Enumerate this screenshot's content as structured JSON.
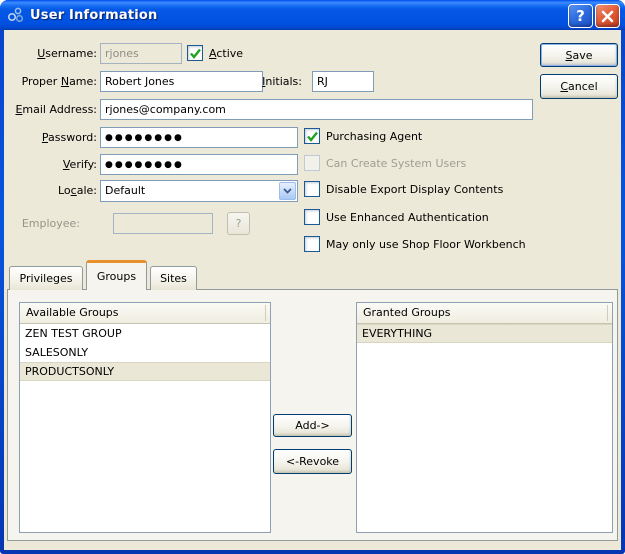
{
  "window": {
    "title": "User Information",
    "help_glyph": "?"
  },
  "form": {
    "username": {
      "label": {
        "text": "Username:",
        "u": 0
      },
      "value": "rjones",
      "disabled": true
    },
    "active": {
      "label": {
        "text": "Active",
        "u": 0
      },
      "checked": true
    },
    "proper_name": {
      "label": {
        "text": "Proper Name:",
        "u": 7
      },
      "value": "Robert Jones"
    },
    "initials": {
      "label": {
        "text": "Initials:",
        "u": 0
      },
      "value": "RJ"
    },
    "email": {
      "label": {
        "text": "Email Address:",
        "u": 0
      },
      "value": "rjones@company.com"
    },
    "password": {
      "label": {
        "text": "Password:",
        "u": 0
      },
      "value": "●●●●●●●●"
    },
    "verify": {
      "label": {
        "text": "Verify:",
        "u": 0
      },
      "value": "●●●●●●●●"
    },
    "locale": {
      "label": {
        "text": "Locale:",
        "u": 2
      },
      "value": "Default"
    },
    "employee": {
      "label": {
        "text": "Employee:"
      },
      "value": "",
      "disabled": true,
      "lookup_label": "?"
    }
  },
  "checkboxes": {
    "purchasing_agent": {
      "label": "Purchasing Agent",
      "checked": true
    },
    "can_create_users": {
      "label": "Can Create System Users",
      "checked": false,
      "disabled": true
    },
    "disable_export": {
      "label": "Disable Export Display Contents",
      "checked": false
    },
    "enhanced_auth": {
      "label": "Use Enhanced Authentication",
      "checked": false
    },
    "shop_floor_only": {
      "label": "May only use Shop Floor Workbench",
      "checked": false
    }
  },
  "actions": {
    "save": {
      "text": "Save",
      "u": 0
    },
    "cancel": {
      "text": "Cancel",
      "u": 0
    }
  },
  "tabs": {
    "privileges": "Privileges",
    "groups": "Groups",
    "sites": "Sites"
  },
  "lists": {
    "available": {
      "header": "Available Groups",
      "items": [
        "ZEN TEST GROUP",
        "SALESONLY",
        "PRODUCTSONLY"
      ],
      "selected_index": 2
    },
    "granted": {
      "header": "Granted Groups",
      "items": [
        "EVERYTHING"
      ],
      "selected_index": 0
    }
  },
  "transfer": {
    "add": "Add->",
    "revoke": "<-Revoke"
  }
}
